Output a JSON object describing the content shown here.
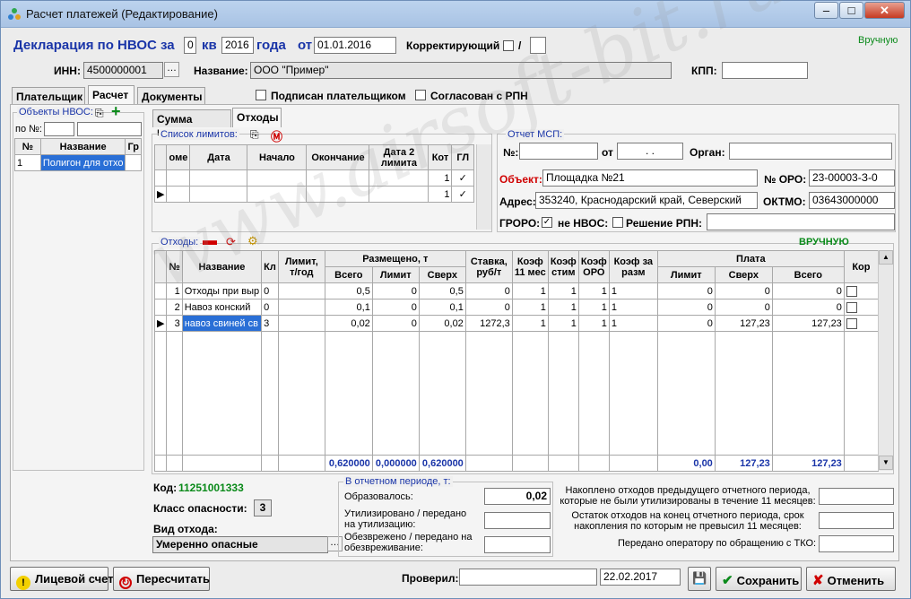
{
  "window": {
    "title": "Расчет платежей (Редактирование)"
  },
  "header": {
    "decl_label": "Декларация по НВОС за",
    "quarter": "0",
    "quarter_label": "кв",
    "year": "2016",
    "year_label": "года",
    "from_label": "от",
    "date": "01.01.2016",
    "corr_label": "Корректирующий",
    "corr_sep": "/",
    "mode": "Вручную",
    "inn_label": "ИНН:",
    "inn": "4500000001",
    "name_label": "Название:",
    "name": "ООО \"Пример\"",
    "kpp_label": "КПП:"
  },
  "tabs": [
    "Плательщик",
    "Расчет",
    "Документы"
  ],
  "signed_label": "Подписан плательщиком",
  "agreed_label": "Согласован с РПН",
  "left": {
    "title": "Объекты НВОС:",
    "no_label": "по №:",
    "cols": [
      "№",
      "Название",
      "Гр"
    ],
    "rows": [
      {
        "n": "1",
        "name": "Полигон для отхо"
      }
    ]
  },
  "subtabs": [
    "Сумма платы",
    "Отходы"
  ],
  "limits": {
    "title": "Список лимитов:",
    "cols": [
      "оме",
      "Дата",
      "Начало",
      "Окончание",
      "Дата 2 лимита",
      "Кот",
      "ГЛ"
    ],
    "rows": [
      {
        "kot": "1",
        "gl": "✓"
      },
      {
        "kot": "1",
        "gl": "✓"
      }
    ]
  },
  "msp": {
    "title": "Отчет МСП:",
    "no_label": "№:",
    "from_label": "от",
    "date": ". .",
    "organ_label": "Орган:",
    "object_label": "Объект:",
    "object": "Площадка №21",
    "oro_label": "№ ОРО:",
    "oro": "23-00003-З-0",
    "addr_label": "Адрес:",
    "addr": "353240, Краснодарский край, Северский",
    "oktmo_label": "ОКТМО:",
    "oktmo": "03643000000",
    "groro_label": "ГРОРО:",
    "groro_check": "✓",
    "nenvos_label": "не НВОС:",
    "rpn_label": "Решение РПН:"
  },
  "waste": {
    "title": "Отходы:",
    "mode": "ВРУЧНУЮ",
    "h1": [
      "№",
      "Название",
      "Кл",
      "Лимит, т/год",
      "Размещено, т",
      "Ставка, руб/т",
      "Коэф 11 мес",
      "Коэф стим",
      "Коэф ОРО",
      "Коэф за разм",
      "Плата",
      "Кор"
    ],
    "h2": [
      "Всего",
      "Лимит",
      "Сверх",
      "Лимит",
      "Сверх",
      "Всего"
    ],
    "rows": [
      {
        "n": "1",
        "name": "Отходы при выр",
        "kl": "0",
        "lim": "",
        "all": "0,5",
        "limit": "0",
        "over": "0,5",
        "rate": "0",
        "k11": "1",
        "kst": "1",
        "koro": "1",
        "kraz": "1",
        "plim": "0",
        "pover": "0",
        "pall": "0"
      },
      {
        "n": "2",
        "name": "Навоз конский",
        "kl": "0",
        "lim": "",
        "all": "0,1",
        "limit": "0",
        "over": "0,1",
        "rate": "0",
        "k11": "1",
        "kst": "1",
        "koro": "1",
        "kraz": "1",
        "plim": "0",
        "pover": "0",
        "pall": "0"
      },
      {
        "n": "3",
        "name": "навоз свиней св",
        "kl": "3",
        "lim": "",
        "all": "0,02",
        "limit": "0",
        "over": "0,02",
        "rate": "1272,3",
        "k11": "1",
        "kst": "1",
        "koro": "1",
        "kraz": "1",
        "plim": "0",
        "pover": "127,23",
        "pall": "127,23"
      }
    ],
    "totals": {
      "all": "0,620000",
      "limit": "0,000000",
      "over": "0,620000",
      "plim": "0,00",
      "pover": "127,23",
      "pall": "127,23"
    }
  },
  "bottom": {
    "code_label": "Код:",
    "code": "11251001333",
    "class_label": "Класс опасности:",
    "class": "3",
    "type_label": "Вид отхода:",
    "type": "Умеренно опасные",
    "period_title": "В отчетном периоде, т:",
    "formed_label": "Образовалось:",
    "formed": "0,02",
    "util_label": "Утилизировано / передано на утилизацию:",
    "neut_label": "Обезврежено / передано на обезвреживание:",
    "acc_label": "Накоплено отходов предыдущего отчетного периода, которые не были утилизированы в течение 11 месяцев:",
    "rest_label": "Остаток отходов на конец отчетного периода, срок накопления по которым не превысил 11 месяцев:",
    "tko_label": "Передано оператору по обращению с ТКО:"
  },
  "footer": {
    "account": "Лицевой счет",
    "recalc": "Пересчитать",
    "checked_label": "Проверил:",
    "date": "22.02.2017",
    "save": "Сохранить",
    "cancel": "Отменить"
  },
  "watermark": "www.airsoft-bit.ru"
}
